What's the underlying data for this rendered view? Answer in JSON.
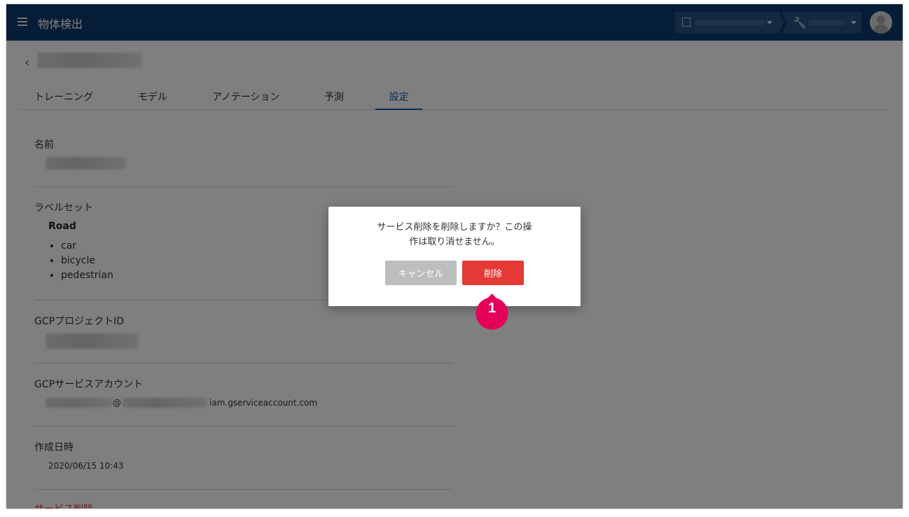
{
  "app": {
    "title": "物体検出"
  },
  "header": {
    "tool_icon": "🔧"
  },
  "tabs": [
    {
      "label": "トレーニング"
    },
    {
      "label": "モデル"
    },
    {
      "label": "アノテーション"
    },
    {
      "label": "予測"
    },
    {
      "label": "設定"
    }
  ],
  "active_tab": "設定",
  "settings": {
    "name_label": "名前",
    "labelset_label": "ラベルセット",
    "labelset_name": "Road",
    "labels": [
      "car",
      "bicycle",
      "pedestrian"
    ],
    "gcp_project_label": "GCPプロジェクトID",
    "gcp_service_label": "GCPサービスアカウント",
    "service_account_at": "@",
    "service_account_suffix": "iam.gserviceaccount.com",
    "created_label": "作成日時",
    "created_value": "2020/06/15 10:43",
    "service_delete_label": "サービス削除"
  },
  "dialog": {
    "message_line1": "サービス削除を削除しますか？この操",
    "message_line2": "作は取り消せません。",
    "cancel_label": "キャンセル",
    "delete_label": "削除"
  },
  "callout": {
    "number": "1"
  },
  "colors": {
    "appbar": "#0d3b6e",
    "accent": "#1a5a9e",
    "danger": "#e53935",
    "callout": "#e5005a",
    "cancel": "#bdbdbd"
  }
}
